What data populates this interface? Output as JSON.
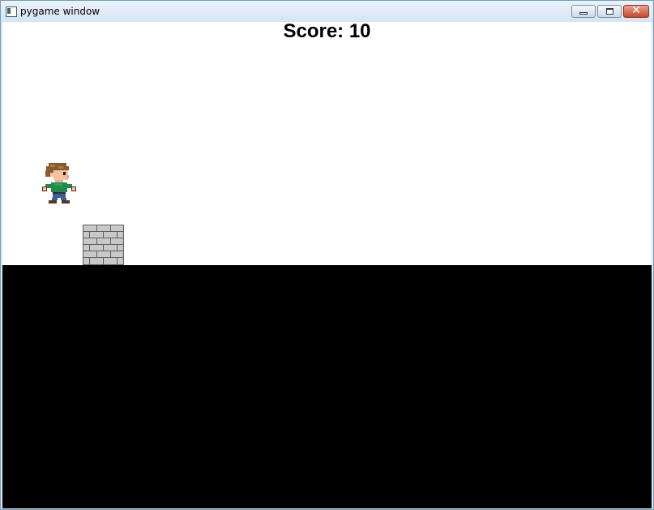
{
  "window": {
    "title": "pygame window",
    "minimize_glyph": "",
    "maximize_glyph": "",
    "close_glyph": "✕"
  },
  "hud": {
    "score_text": "Score: 10"
  },
  "scene": {
    "sky_color": "#ffffff",
    "ground_color": "#000000",
    "player_sprite": "pixel-boy-green-shirt",
    "obstacle_sprite": "grey-brick-block"
  }
}
